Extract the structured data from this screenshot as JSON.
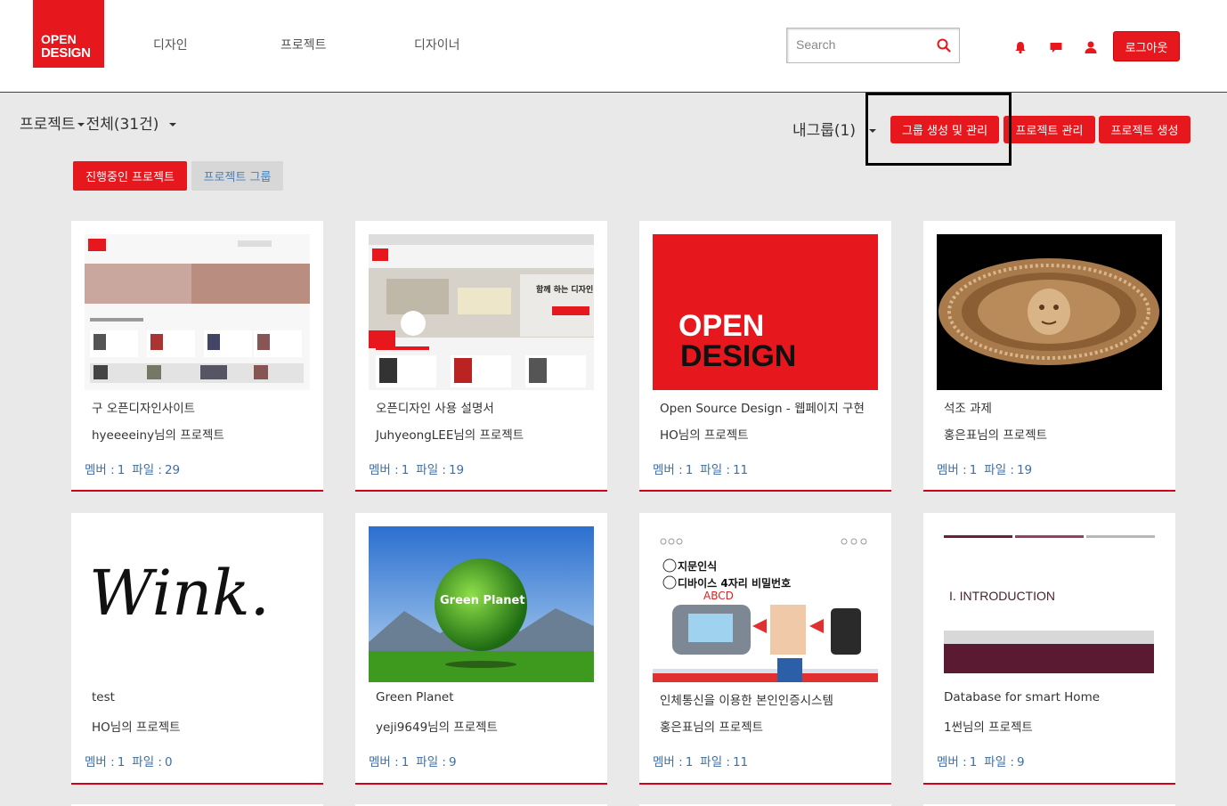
{
  "logo": {
    "line1": "OPEN",
    "line2": "DESIGN"
  },
  "nav": [
    "디자인",
    "프로젝트",
    "디자이너"
  ],
  "search": {
    "placeholder": "Search",
    "value": ""
  },
  "header_icons": [
    "bell-icon",
    "message-icon",
    "user-icon"
  ],
  "logout_label": "로그아웃",
  "page": {
    "category": "프로젝트",
    "filter": "전체(31건)",
    "my_group": "내그룹(1)"
  },
  "actions": {
    "group_manage": "그룹 생성 및 관리",
    "project_manage": "프로젝트 관리",
    "project_create": "프로젝트 생성"
  },
  "tabs": {
    "active": "진행중인 프로젝트",
    "inactive": "프로젝트 그룹"
  },
  "stat_labels": {
    "members": "멤버 :",
    "files": "파일 :"
  },
  "cards": [
    {
      "title": "구 오픈디자인사이트",
      "owner": "hyeeeeiny님의 프로젝트",
      "members": "1",
      "files": "29"
    },
    {
      "title": "오픈디자인 사용 설명서",
      "owner": "JuhyeongLEE님의 프로젝트",
      "members": "1",
      "files": "19",
      "overlay": "함께 하는 디자인"
    },
    {
      "title": "Open Source Design - 웹페이지 구현",
      "owner": "HO님의 프로젝트",
      "members": "1",
      "files": "11",
      "overlay1": "OPEN",
      "overlay2": "DESIGN"
    },
    {
      "title": "석조 과제",
      "owner": "홍은표님의 프로젝트",
      "members": "1",
      "files": "19"
    },
    {
      "title": "test",
      "owner": "HO님의 프로젝트",
      "members": "1",
      "files": "0",
      "overlay": "Wink."
    },
    {
      "title": "Green Planet",
      "owner": "yeji9649님의 프로젝트",
      "members": "1",
      "files": "9",
      "overlay": "Green Planet"
    },
    {
      "title": "인체통신을 이용한 본인인증시스템",
      "owner": "홍은표님의 프로젝트",
      "members": "1",
      "files": "11",
      "overlay1": "지문인식",
      "overlay2": "디바이스 4자리 비밀번호",
      "overlay3": "ABCD"
    },
    {
      "title": "Database for smart Home",
      "owner": "1썬님의 프로젝트",
      "members": "1",
      "files": "9",
      "overlay": "I. INTRODUCTION"
    }
  ],
  "colors": {
    "brand": "#e6181e",
    "link": "#3d6fa8",
    "background": "#e9e9e9"
  }
}
